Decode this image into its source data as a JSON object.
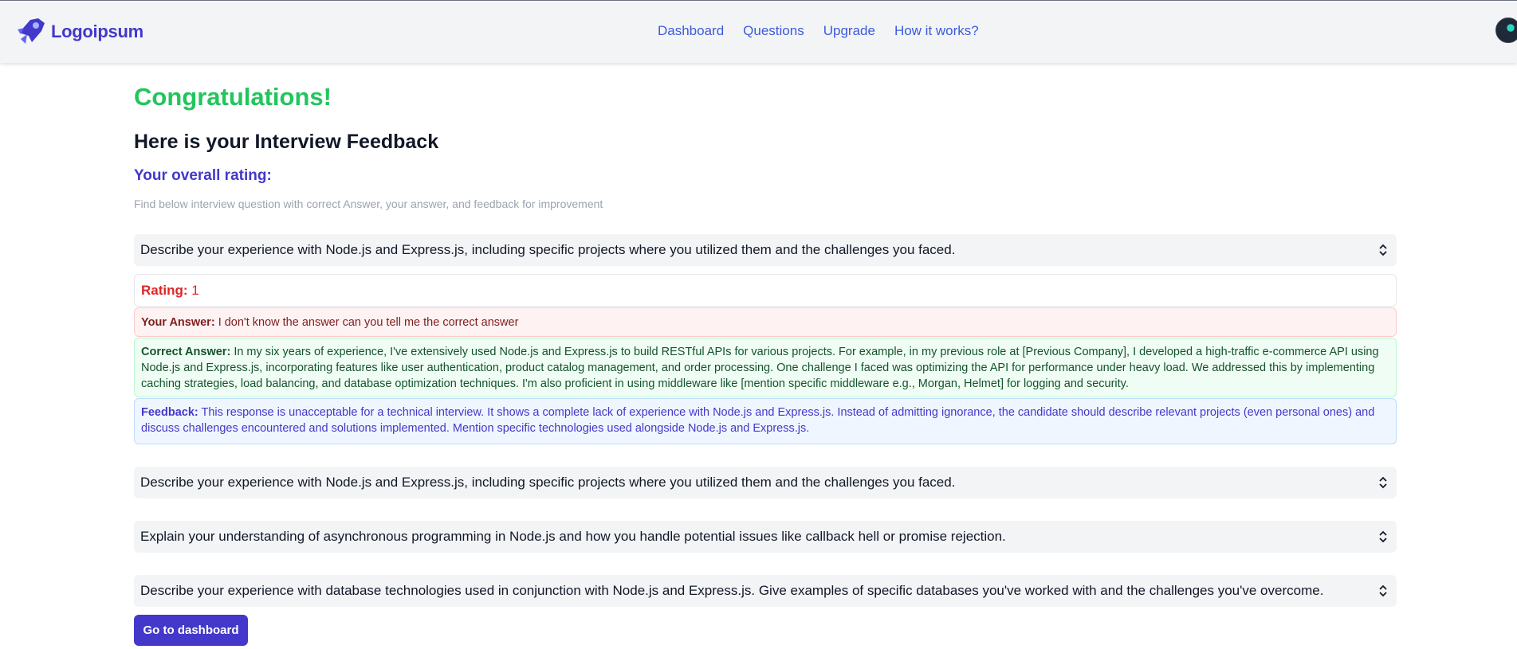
{
  "header": {
    "brand_name": "Logoipsum",
    "nav": [
      "Dashboard",
      "Questions",
      "Upgrade",
      "How it works?"
    ]
  },
  "page": {
    "congrats": "Congratulations!",
    "subtitle": "Here is your Interview Feedback",
    "rating_heading": "Your overall rating:",
    "intro": "Find below interview question with correct Answer, your answer, and feedback for improvement"
  },
  "questions": [
    "Describe your experience with Node.js and Express.js, including specific projects where you utilized them and the challenges you faced.",
    "Describe your experience with Node.js and Express.js, including specific projects where you utilized them and the challenges you faced.",
    "Explain your understanding of asynchronous programming in Node.js and how you handle potential issues like callback hell or promise rejection.",
    "Describe your experience with database technologies used in conjunction with Node.js and Express.js. Give examples of specific databases you've worked with and the challenges you've overcome."
  ],
  "expanded": {
    "rating_label": "Rating:",
    "rating_value": "1",
    "your_answer_label": "Your Answer:",
    "your_answer": "I don't know the answer can you tell me the correct answer",
    "correct_answer_label": "Correct Answer:",
    "correct_answer": "In my six years of experience, I've extensively used Node.js and Express.js to build RESTful APIs for various projects. For example, in my previous role at [Previous Company], I developed a high-traffic e-commerce API using Node.js and Express.js, incorporating features like user authentication, product catalog management, and order processing. One challenge I faced was optimizing the API for performance under heavy load. We addressed this by implementing caching strategies, load balancing, and database optimization techniques. I'm also proficient in using middleware like [mention specific middleware e.g., Morgan, Helmet] for logging and security.",
    "feedback_label": "Feedback:",
    "feedback": "This response is unacceptable for a technical interview. It shows a complete lack of experience with Node.js and Express.js. Instead of admitting ignorance, the candidate should describe relevant projects (even personal ones) and discuss challenges encountered and solutions implemented. Mention specific technologies used alongside Node.js and Express.js."
  },
  "button": {
    "dashboard_label": "Go to dashboard"
  },
  "colors": {
    "accent": "#4338ca",
    "success": "#22c55e",
    "danger": "#dc2626",
    "nav_link": "#3b5bdb"
  },
  "icons": [
    "logo-icon",
    "chevron-updown-icon",
    "avatar"
  ]
}
